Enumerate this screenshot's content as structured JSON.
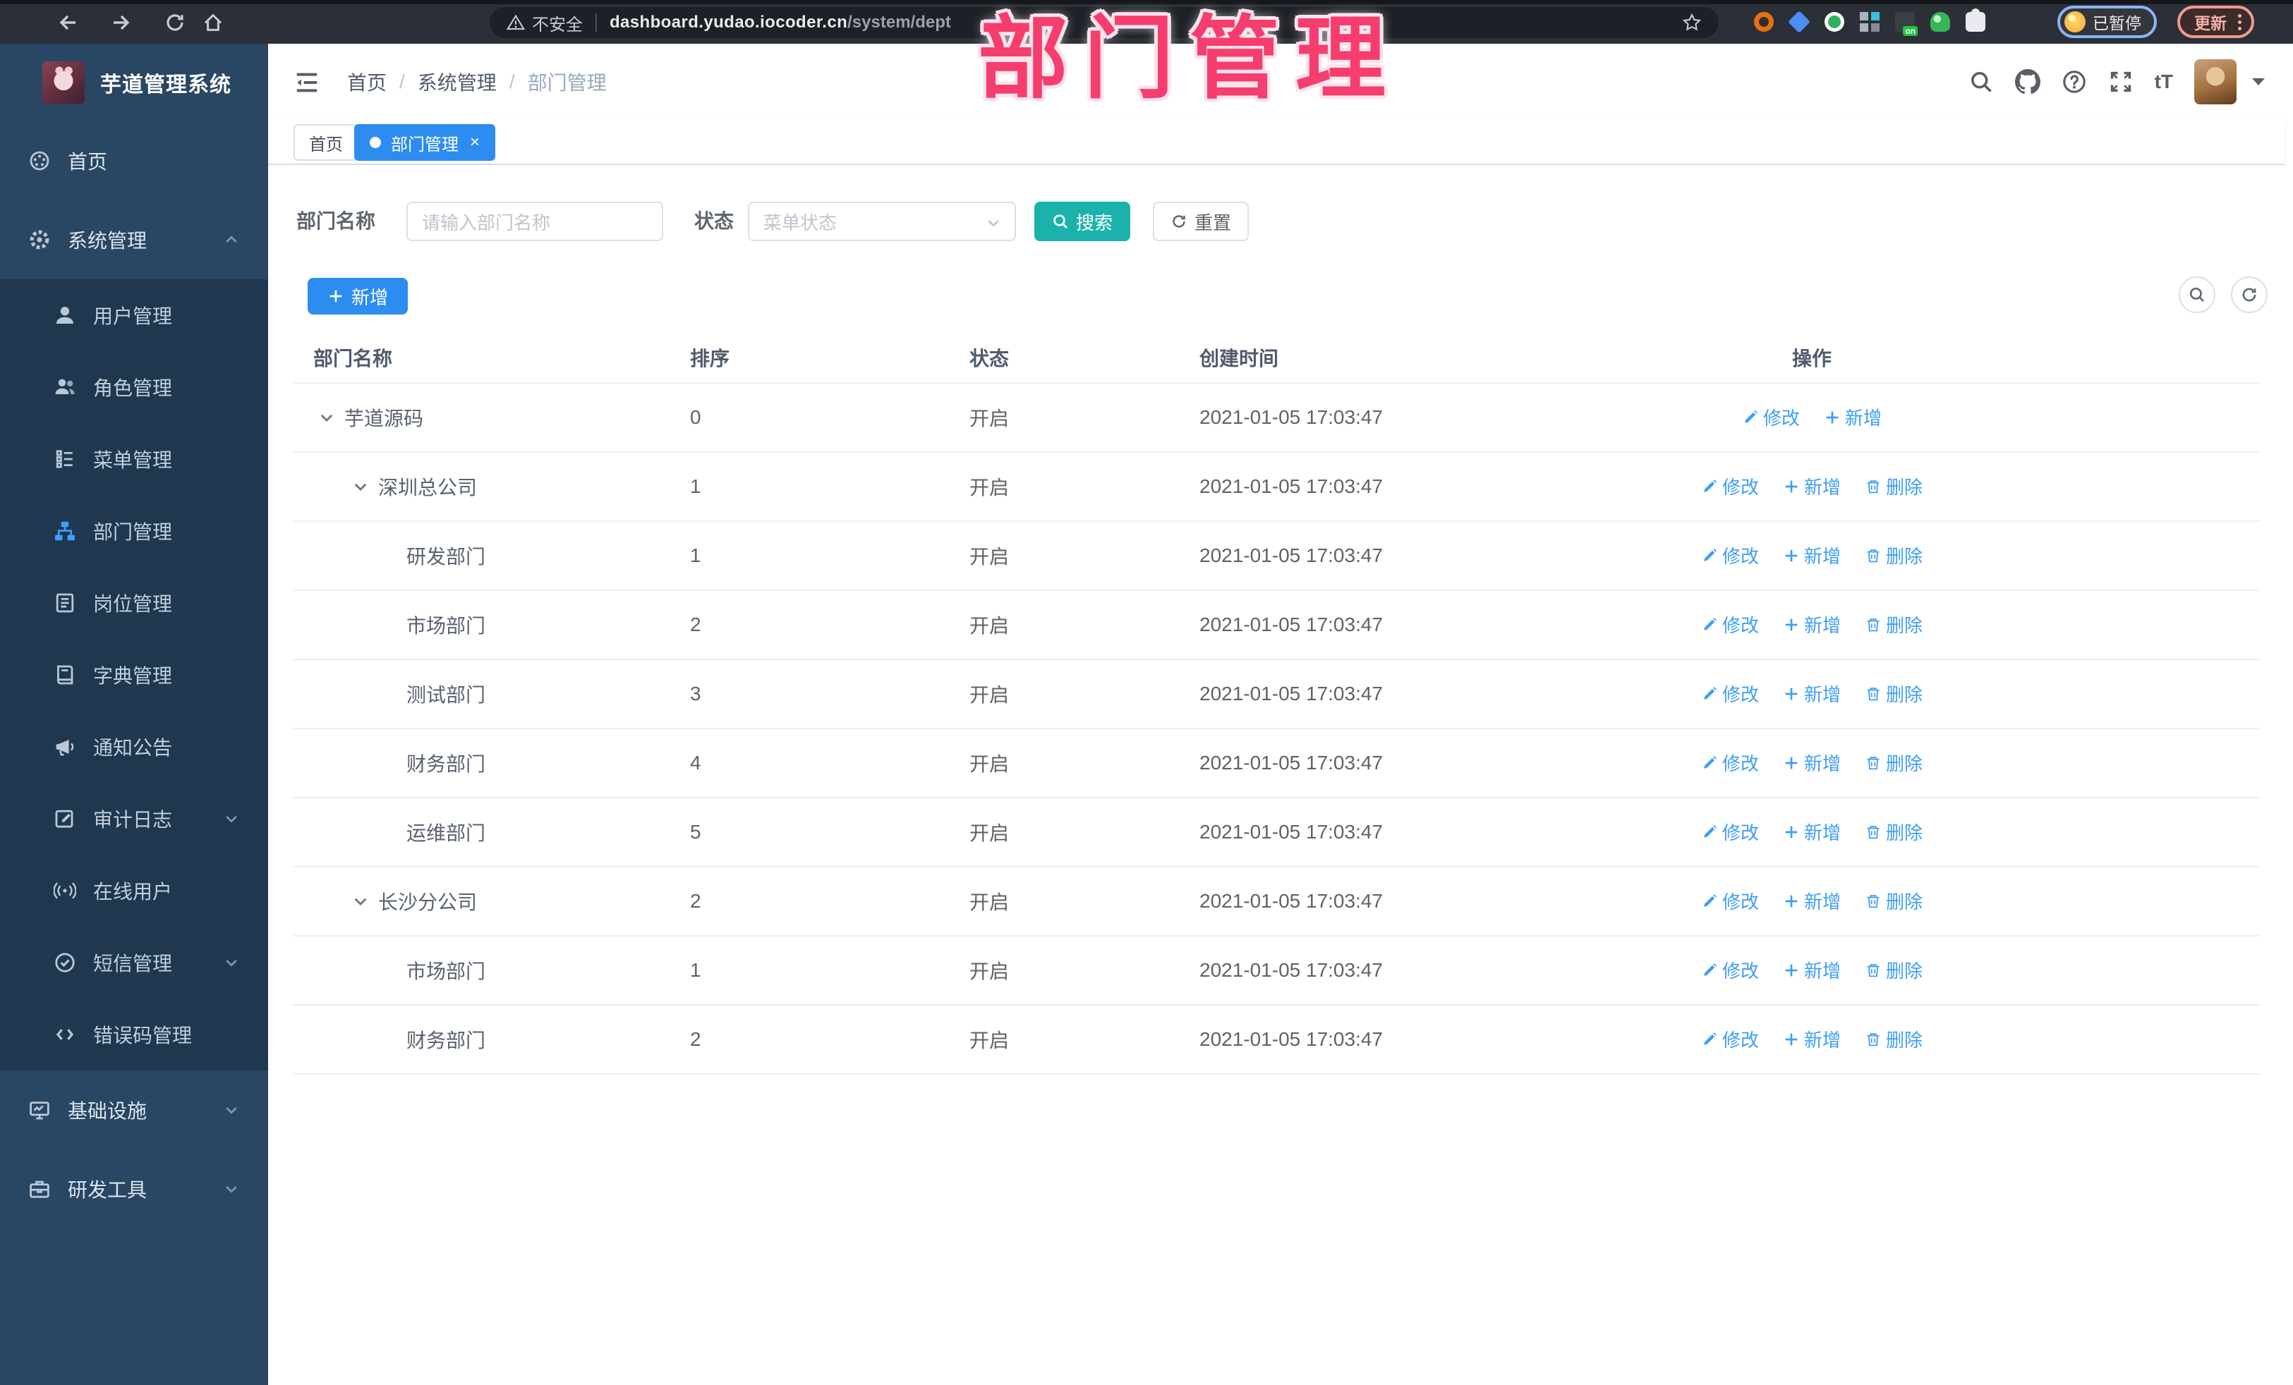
{
  "browser": {
    "security_label": "不安全",
    "url_host": "dashboard.yudao.iocoder.cn",
    "url_path": "/system/dept",
    "profile_status_label": "已暂停",
    "update_label": "更新"
  },
  "overlay_title": "部门管理",
  "sidebar": {
    "app_title": "芋道管理系统",
    "top_items": [
      {
        "label": "首页",
        "icon": "dashboard-icon"
      },
      {
        "label": "系统管理",
        "icon": "gear-icon",
        "caret": "up"
      }
    ],
    "sub_items": [
      {
        "label": "用户管理",
        "icon": "user-icon"
      },
      {
        "label": "角色管理",
        "icon": "role-icon"
      },
      {
        "label": "菜单管理",
        "icon": "menu-tree-icon"
      },
      {
        "label": "部门管理",
        "icon": "dept-tree-icon",
        "active": true
      },
      {
        "label": "岗位管理",
        "icon": "post-icon"
      },
      {
        "label": "字典管理",
        "icon": "dict-icon"
      },
      {
        "label": "通知公告",
        "icon": "notice-icon"
      },
      {
        "label": "审计日志",
        "icon": "audit-icon",
        "caret": "down"
      },
      {
        "label": "在线用户",
        "icon": "online-icon"
      },
      {
        "label": "短信管理",
        "icon": "sms-icon",
        "caret": "down"
      },
      {
        "label": "错误码管理",
        "icon": "errcode-icon"
      }
    ],
    "bottom_items": [
      {
        "label": "基础设施",
        "icon": "infra-icon",
        "caret": "down"
      },
      {
        "label": "研发工具",
        "icon": "tools-icon",
        "caret": "down"
      }
    ]
  },
  "header": {
    "breadcrumb": [
      "首页",
      "系统管理",
      "部门管理"
    ],
    "font_size_icon_label": "tT"
  },
  "tabs": [
    {
      "label": "首页",
      "active": false
    },
    {
      "label": "部门管理",
      "active": true,
      "closable": true
    }
  ],
  "filter": {
    "name_label": "部门名称",
    "name_placeholder": "请输入部门名称",
    "status_label": "状态",
    "status_placeholder": "菜单状态",
    "search_label": "搜索",
    "reset_label": "重置"
  },
  "toolbar": {
    "add_label": "新增"
  },
  "table": {
    "columns": [
      "部门名称",
      "排序",
      "状态",
      "创建时间",
      "操作"
    ],
    "rows": [
      {
        "name": "芋道源码",
        "level": 0,
        "expanded": true,
        "sort": "0",
        "status": "开启",
        "created": "2021-01-05 17:03:47",
        "actions": [
          {
            "type": "edit",
            "label": "修改"
          },
          {
            "type": "add",
            "label": "新增"
          }
        ]
      },
      {
        "name": "深圳总公司",
        "level": 1,
        "expanded": true,
        "sort": "1",
        "status": "开启",
        "created": "2021-01-05 17:03:47",
        "actions": [
          {
            "type": "edit",
            "label": "修改"
          },
          {
            "type": "add",
            "label": "新增"
          },
          {
            "type": "delete",
            "label": "删除"
          }
        ]
      },
      {
        "name": "研发部门",
        "level": 2,
        "expanded": false,
        "sort": "1",
        "status": "开启",
        "created": "2021-01-05 17:03:47",
        "actions": [
          {
            "type": "edit",
            "label": "修改"
          },
          {
            "type": "add",
            "label": "新增"
          },
          {
            "type": "delete",
            "label": "删除"
          }
        ]
      },
      {
        "name": "市场部门",
        "level": 2,
        "expanded": false,
        "sort": "2",
        "status": "开启",
        "created": "2021-01-05 17:03:47",
        "actions": [
          {
            "type": "edit",
            "label": "修改"
          },
          {
            "type": "add",
            "label": "新增"
          },
          {
            "type": "delete",
            "label": "删除"
          }
        ]
      },
      {
        "name": "测试部门",
        "level": 2,
        "expanded": false,
        "sort": "3",
        "status": "开启",
        "created": "2021-01-05 17:03:47",
        "actions": [
          {
            "type": "edit",
            "label": "修改"
          },
          {
            "type": "add",
            "label": "新增"
          },
          {
            "type": "delete",
            "label": "删除"
          }
        ]
      },
      {
        "name": "财务部门",
        "level": 2,
        "expanded": false,
        "sort": "4",
        "status": "开启",
        "created": "2021-01-05 17:03:47",
        "actions": [
          {
            "type": "edit",
            "label": "修改"
          },
          {
            "type": "add",
            "label": "新增"
          },
          {
            "type": "delete",
            "label": "删除"
          }
        ]
      },
      {
        "name": "运维部门",
        "level": 2,
        "expanded": false,
        "sort": "5",
        "status": "开启",
        "created": "2021-01-05 17:03:47",
        "actions": [
          {
            "type": "edit",
            "label": "修改"
          },
          {
            "type": "add",
            "label": "新增"
          },
          {
            "type": "delete",
            "label": "删除"
          }
        ]
      },
      {
        "name": "长沙分公司",
        "level": 1,
        "expanded": true,
        "sort": "2",
        "status": "开启",
        "created": "2021-01-05 17:03:47",
        "actions": [
          {
            "type": "edit",
            "label": "修改"
          },
          {
            "type": "add",
            "label": "新增"
          },
          {
            "type": "delete",
            "label": "删除"
          }
        ]
      },
      {
        "name": "市场部门",
        "level": 2,
        "expanded": false,
        "sort": "1",
        "status": "开启",
        "created": "2021-01-05 17:03:47",
        "actions": [
          {
            "type": "edit",
            "label": "修改"
          },
          {
            "type": "add",
            "label": "新增"
          },
          {
            "type": "delete",
            "label": "删除"
          }
        ]
      },
      {
        "name": "财务部门",
        "level": 2,
        "expanded": false,
        "sort": "2",
        "status": "开启",
        "created": "2021-01-05 17:03:47",
        "actions": [
          {
            "type": "edit",
            "label": "修改"
          },
          {
            "type": "add",
            "label": "新增"
          },
          {
            "type": "delete",
            "label": "删除"
          }
        ]
      }
    ]
  }
}
